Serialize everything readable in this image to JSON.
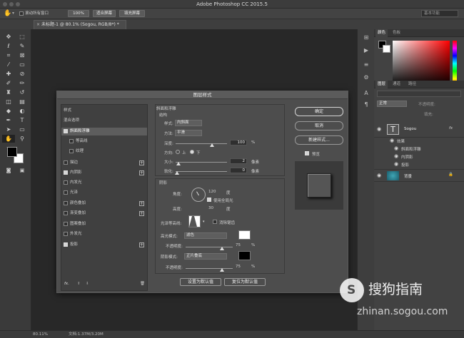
{
  "window": {
    "title": "Adobe Photoshop CC 2015.5"
  },
  "options_bar": {
    "scroll_all_label": "滚动所有窗口",
    "zoom_100_label": "100%",
    "fit_screen_label": "适合屏幕",
    "fill_screen_label": "填充屏幕",
    "search_placeholder": "基本功能"
  },
  "document_tab": {
    "label": "未标题-1 @ 80.1% (Sogou, RGB/8*) *"
  },
  "dialog": {
    "title": "图层样式",
    "styles_header": "样式",
    "blend_options": "混合选项",
    "effects": [
      {
        "label": "斜面和浮雕",
        "checked": true,
        "selected": true
      },
      {
        "label": "等高线",
        "checked": false,
        "indent": true
      },
      {
        "label": "纹理",
        "checked": false,
        "indent": true
      },
      {
        "label": "描边",
        "checked": false,
        "plus": true
      },
      {
        "label": "内阴影",
        "checked": true,
        "plus": true
      },
      {
        "label": "内发光",
        "checked": false
      },
      {
        "label": "光泽",
        "checked": false
      },
      {
        "label": "颜色叠加",
        "checked": false,
        "plus": true
      },
      {
        "label": "渐变叠加",
        "checked": false,
        "plus": true
      },
      {
        "label": "图案叠加",
        "checked": false
      },
      {
        "label": "外发光",
        "checked": false
      },
      {
        "label": "投影",
        "checked": true,
        "plus": true
      }
    ],
    "fx_label": "fx.",
    "bevel_group_title": "斜面和浮雕",
    "structure_title": "结构",
    "style_label": "样式:",
    "style_value": "内斜面",
    "technique_label": "方法:",
    "technique_value": "平滑",
    "depth_label": "深度:",
    "depth_value": "100",
    "depth_unit": "%",
    "direction_label": "方向:",
    "dir_up": "上",
    "dir_down": "下",
    "size_label": "大小:",
    "size_value": "2",
    "size_unit": "像素",
    "soften_label": "软化:",
    "soften_value": "0",
    "soften_unit": "像素",
    "shading_title": "阴影",
    "angle_label": "角度:",
    "angle_value": "120",
    "angle_unit": "度",
    "global_light_label": "使用全局光",
    "altitude_label": "高度:",
    "altitude_value": "30",
    "altitude_unit": "度",
    "gloss_label": "光泽等高线:",
    "antialias_label": "消除锯齿",
    "highlight_mode_label": "高光模式:",
    "highlight_mode_value": "滤色",
    "highlight_opacity_label": "不透明度:",
    "highlight_opacity_value": "75",
    "shadow_mode_label": "阴影模式:",
    "shadow_mode_value": "正片叠底",
    "shadow_opacity_label": "不透明度:",
    "shadow_opacity_value": "75",
    "percent": "%",
    "set_default": "设置为默认值",
    "reset_default": "复位为默认值",
    "ok": "确定",
    "cancel": "取消",
    "new_style": "新建样式...",
    "preview_label": "预览"
  },
  "right_panel": {
    "color_tab": "颜色",
    "swatches_tab": "色板",
    "layers_tab": "图层",
    "channels_tab": "通道",
    "paths_tab": "路径",
    "blend_mode": "正常",
    "opacity_label": "不透明度:",
    "fill_label": "填充:",
    "layers": {
      "text_layer": "Sogou",
      "effects_label": "效果",
      "effect_items": [
        "斜面和浮雕",
        "内阴影",
        "投影"
      ],
      "background": "背景"
    }
  },
  "status": {
    "zoom": "80.11%",
    "doc_info": "文档:1.37M/3.20M"
  },
  "watermark": {
    "brand": "搜狗指南",
    "url": "zhinan.sogou.com"
  },
  "colors": {
    "accent_red": "#ff0000",
    "bg_dark": "#282828",
    "panel": "#424242"
  }
}
